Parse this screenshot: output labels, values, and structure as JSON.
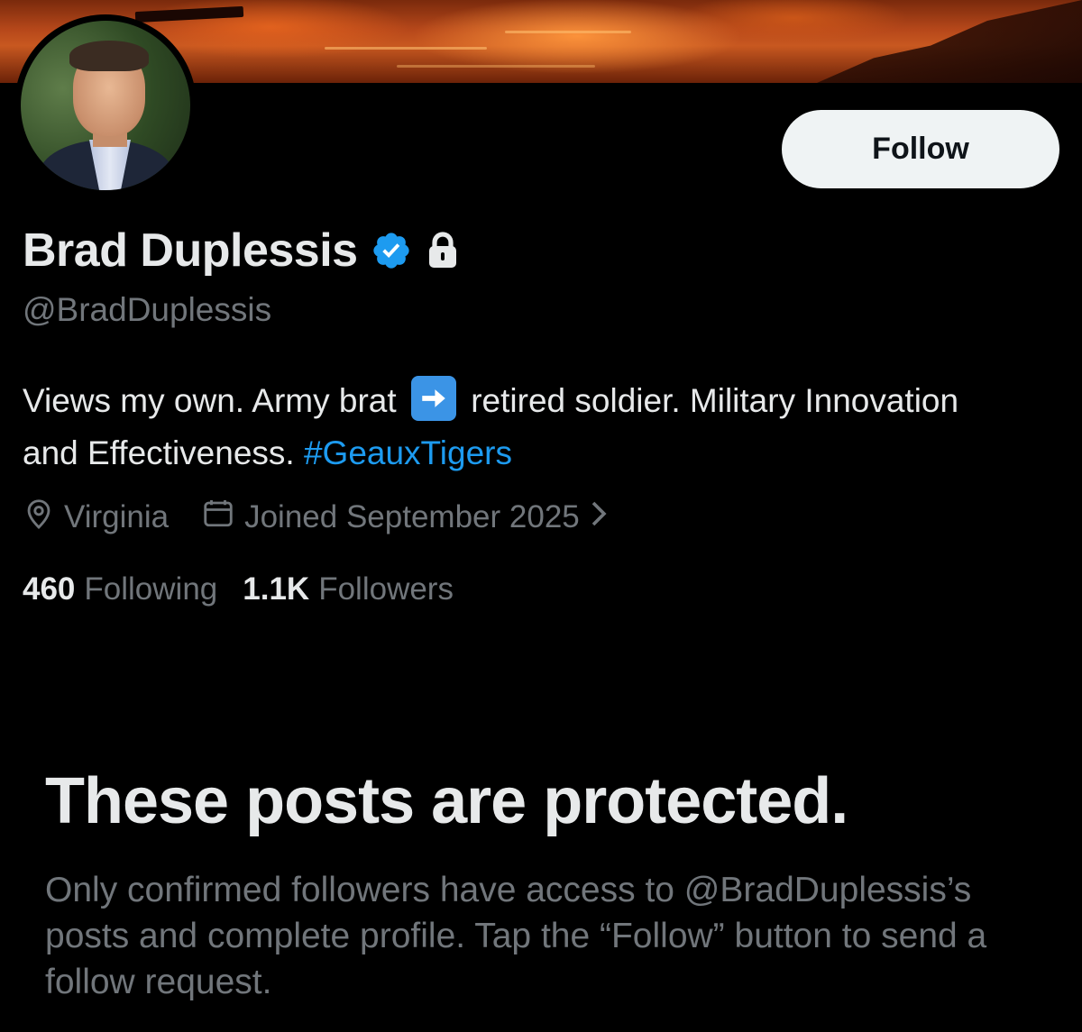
{
  "profile": {
    "display_name": "Brad Duplessis",
    "handle": "@BradDuplessis",
    "verified": true,
    "protected": true,
    "bio_part1": "Views my own. Army brat",
    "bio_emoji": "➡️",
    "bio_part2": "retired soldier. Military Innovation and Effectiveness.",
    "bio_hashtag": "#GeauxTigers",
    "location": "Virginia",
    "joined": "Joined September 2025",
    "following_count": "460",
    "following_label": "Following",
    "followers_count": "1.1K",
    "followers_label": "Followers"
  },
  "actions": {
    "follow_label": "Follow"
  },
  "protected_notice": {
    "title": "These posts are protected.",
    "body": "Only confirmed followers have access to @BradDuplessis’s posts and complete profile. Tap the “Follow” button to send a follow request."
  },
  "icons": {
    "verified": "verified-badge-icon",
    "lock": "lock-icon",
    "location": "location-pin-icon",
    "calendar": "calendar-icon",
    "chevron": "chevron-right-icon"
  },
  "colors": {
    "background": "#000000",
    "text": "#e7e9ea",
    "secondary_text": "#71767b",
    "link": "#1d9bf0",
    "verified": "#1d9bf0",
    "follow_button_bg": "#eff3f4"
  }
}
